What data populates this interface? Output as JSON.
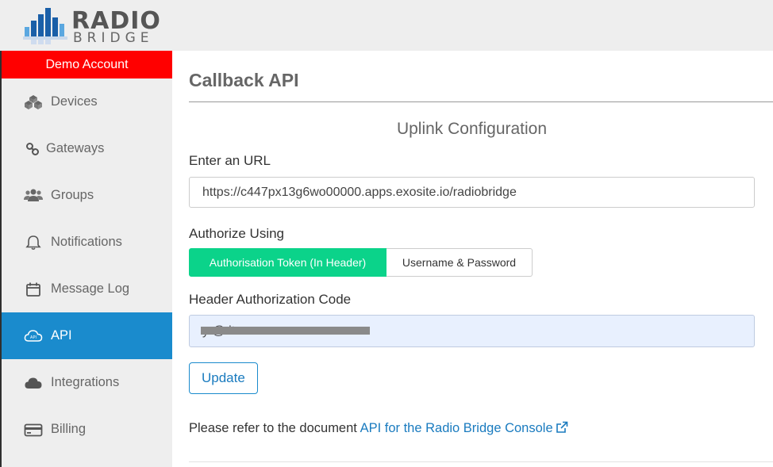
{
  "brand": {
    "word1": "RADIO",
    "word2": "BRIDGE",
    "colors": {
      "bars_dark": "#1a5fa8",
      "bars_light": "#5aa7e0",
      "text": "#555555"
    }
  },
  "sidebar": {
    "account_label": "Demo Account",
    "account_color": "#ff0000",
    "active_color": "#1a8bcd",
    "items": [
      {
        "label": "Devices",
        "icon": "cubes-icon",
        "active": false
      },
      {
        "label": "Gateways",
        "icon": "link-icon",
        "active": false
      },
      {
        "label": "Groups",
        "icon": "users-icon",
        "active": false
      },
      {
        "label": "Notifications",
        "icon": "bell-icon",
        "active": false
      },
      {
        "label": "Message Log",
        "icon": "calendar-icon",
        "active": false
      },
      {
        "label": "API",
        "icon": "cloud-api-icon",
        "active": true
      },
      {
        "label": "Integrations",
        "icon": "cloud-icon",
        "active": false
      },
      {
        "label": "Billing",
        "icon": "credit-card-icon",
        "active": false
      }
    ]
  },
  "main": {
    "page_title": "Callback API",
    "section_title": "Uplink Configuration",
    "url_label": "Enter an URL",
    "url_value": "https://c447px13g6wo00000.apps.exosite.io/radiobridge",
    "authorize_label": "Authorize Using",
    "auth_options": [
      {
        "label": "Authorisation Token (In Header)",
        "selected": true
      },
      {
        "label": "Username & Password",
        "selected": false
      }
    ],
    "header_code_label": "Header Authorization Code",
    "header_code_value": "y          @     it",
    "update_label": "Update",
    "refer_text": "Please refer to the document ",
    "refer_link": "API for the Radio Bridge Console",
    "accent_green": "#0bd38a",
    "link_color": "#1a7bbf"
  }
}
